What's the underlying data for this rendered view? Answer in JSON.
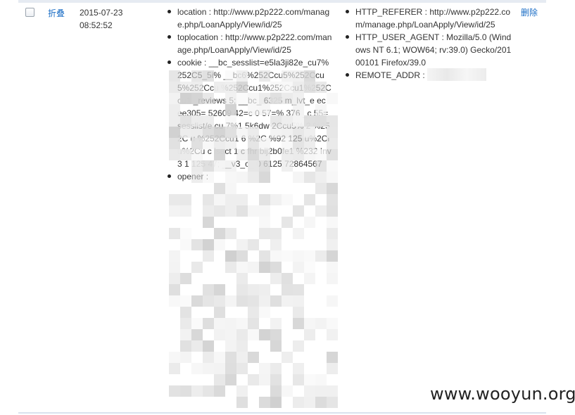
{
  "row": {
    "toggle_label": "折叠",
    "date": "2015-07-23",
    "time": "08:52:52",
    "delete_label": "删除"
  },
  "left_items": [
    "location : http://www.p2p222.com/manage.php/LoanApply/View/id/25",
    "toplocation : http://www.p2p222.com/manage.php/LoanApply/View/id/25",
    "cookie : __bc_sesslist=e5la3ji82e_cu7%252C5_5i% __bc6%252Ccu5%252Ccu5%252Ccu %252Ccu1%252Ccu1%252Ccu1 _reviews 5; __bc_ 6325 m_lvt_e ec ee305= 52609 42=c 0 57=% 376 _c 55=sesslist/e cu 7%1 5k6dw 2Ccu5% 2 %252C u %252Ccu1 6 %2C %92 125 u%2Ci u%2Cu c isact 1 c fhr bij2b0fe1 %232 Inv 3 1 125 47; __v3_c_ 0 6125 72864567",
    "opener :"
  ],
  "right_items": [
    "HTTP_REFERER : http://www.p2p222.com/manage.php/LoanApply/View/id/25",
    "HTTP_USER_AGENT : Mozilla/5.0 (Windows NT 6.1; WOW64; rv:39.0) Gecko/20100101 Firefox/39.0",
    "REMOTE_ADDR :"
  ],
  "watermark": "www.wooyun.org"
}
